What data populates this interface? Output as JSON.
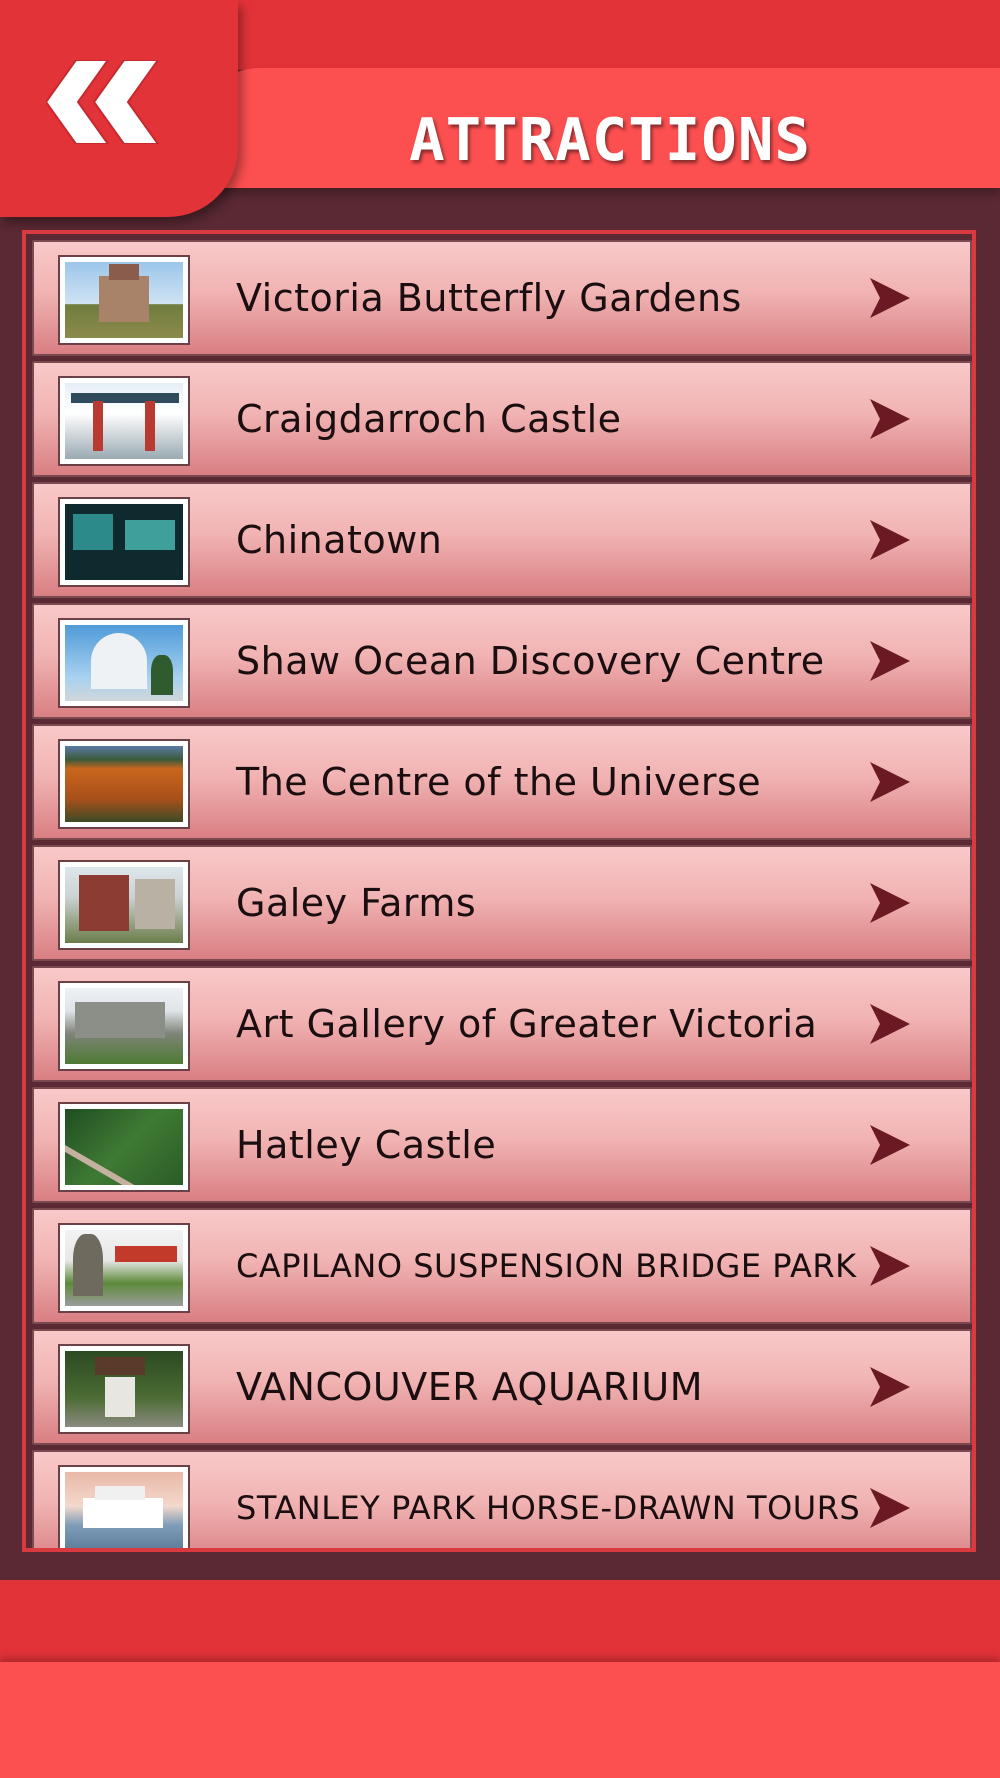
{
  "header": {
    "title": "ATTRACTIONS",
    "back_icon": "double-chevron-left-icon"
  },
  "colors": {
    "header_red": "#e23339",
    "banner_red": "#fc4f50",
    "background": "#5a2933",
    "row_light": "#f9c9c9",
    "row_dark": "#d97f82",
    "arrow": "#6b1a24"
  },
  "attractions": [
    {
      "label": "Victoria Butterfly Gardens"
    },
    {
      "label": "Craigdarroch Castle"
    },
    {
      "label": "Chinatown"
    },
    {
      "label": "Shaw Ocean Discovery Centre"
    },
    {
      "label": "The Centre of the Universe"
    },
    {
      "label": "Galey Farms"
    },
    {
      "label": "Art Gallery of Greater Victoria"
    },
    {
      "label": "Hatley Castle"
    },
    {
      "label": "CAPILANO SUSPENSION BRIDGE PARK"
    },
    {
      "label": "VANCOUVER AQUARIUM"
    },
    {
      "label": "STANLEY PARK HORSE-DRAWN TOURS"
    }
  ]
}
